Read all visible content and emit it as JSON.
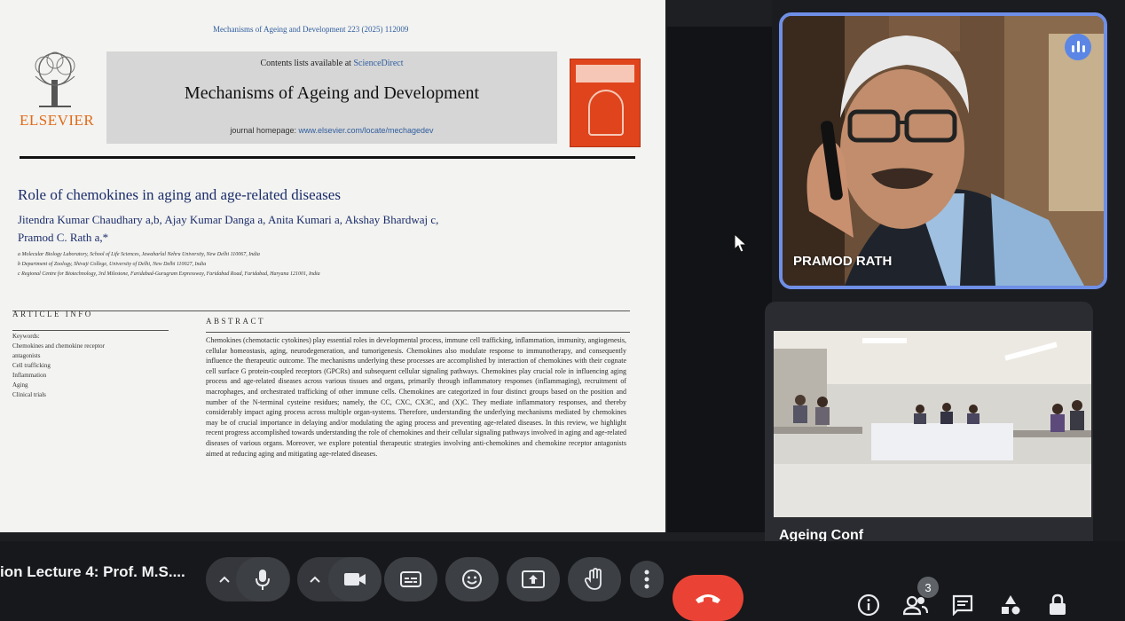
{
  "slide": {
    "citation": "Mechanisms of Ageing and Development 223 (2025) 112009",
    "publisher": "ELSEVIER",
    "contents_prefix": "Contents lists available at ",
    "contents_link": "ScienceDirect",
    "journal_name": "Mechanisms of Ageing and Development",
    "homepage_prefix": "journal homepage: ",
    "homepage_url": "www.elsevier.com/locate/mechagedev",
    "paper_title": "Role of chemokines in aging and age-related diseases",
    "authors_line1": "Jitendra Kumar Chaudhary a,b, Ajay Kumar Danga a, Anita Kumari a, Akshay Bhardwaj c,",
    "authors_line2": "Pramod C. Rath a,*",
    "affiliations": [
      "a Molecular Biology Laboratory, School of Life Sciences, Jawaharlal Nehru University, New Delhi 110067, India",
      "b Department of Zoology, Shivaji College, University of Delhi, New Delhi 110027, India",
      "c Regional Centre for Biotechnology, 3rd Milestone, Faridabad-Gurugram Expressway, Faridabad Road, Faridabad, Haryana 121001, India"
    ],
    "article_info_heading": "ARTICLE INFO",
    "keywords": [
      "Keywords:",
      "Chemokines and chemokine receptor",
      "antagonists",
      "Cell trafficking",
      "Inflammation",
      "Aging",
      "Clinical trials"
    ],
    "abstract_heading": "ABSTRACT",
    "abstract_text": "Chemokines (chemotactic cytokines) play essential roles in developmental process, immune cell trafficking, inflammation, immunity, angiogenesis, cellular homeostasis, aging, neurodegeneration, and tumorigenesis. Chemokines also modulate response to immunotherapy, and consequently influence the therapeutic outcome. The mechanisms underlying these processes are accomplished by interaction of chemokines with their cognate cell surface G protein-coupled receptors (GPCRs) and subsequent cellular signaling pathways. Chemokines play crucial role in influencing aging process and age-related diseases across various tissues and organs, primarily through inflammatory responses (inflammaging), recruitment of macrophages, and orchestrated trafficking of other immune cells. Chemokines are categorized in four distinct groups based on the position and number of the N-terminal cysteine residues; namely, the CC, CXC, CX3C, and (X)C. They mediate inflammatory responses, and thereby considerably impact aging process across multiple organ-systems. Therefore, understanding the underlying mechanisms mediated by chemokines may be of crucial importance in delaying and/or modulating the aging process and preventing age-related diseases. In this review, we highlight recent progress accomplished towards understanding the role of chemokines and their cellular signaling pathways involved in aging and age-related diseases of various organs. Moreover, we explore potential therapeutic strategies involving anti-chemokines and chemokine receptor antagonists aimed at reducing aging and mitigating age-related diseases."
  },
  "participants": [
    {
      "name": "PRAMOD RATH",
      "speaking": true
    },
    {
      "name": "Ageing Conf",
      "speaking": false
    }
  ],
  "bottombar": {
    "meeting_title": "ion Lecture 4: Prof. M.S....",
    "participant_count": "3"
  },
  "icons": [
    "chevron-up-icon",
    "microphone-icon",
    "camera-icon",
    "captions-icon",
    "emoji-icon",
    "present-icon",
    "hand-icon",
    "more-icon",
    "end-call-icon",
    "info-icon",
    "people-icon",
    "chat-icon",
    "activities-icon",
    "lock-icon",
    "cursor-icon"
  ],
  "colors": {
    "accent": "#6f8fe6",
    "end_call": "#ea4335",
    "publisher": "#e06a18",
    "link": "#2f5d9e"
  }
}
